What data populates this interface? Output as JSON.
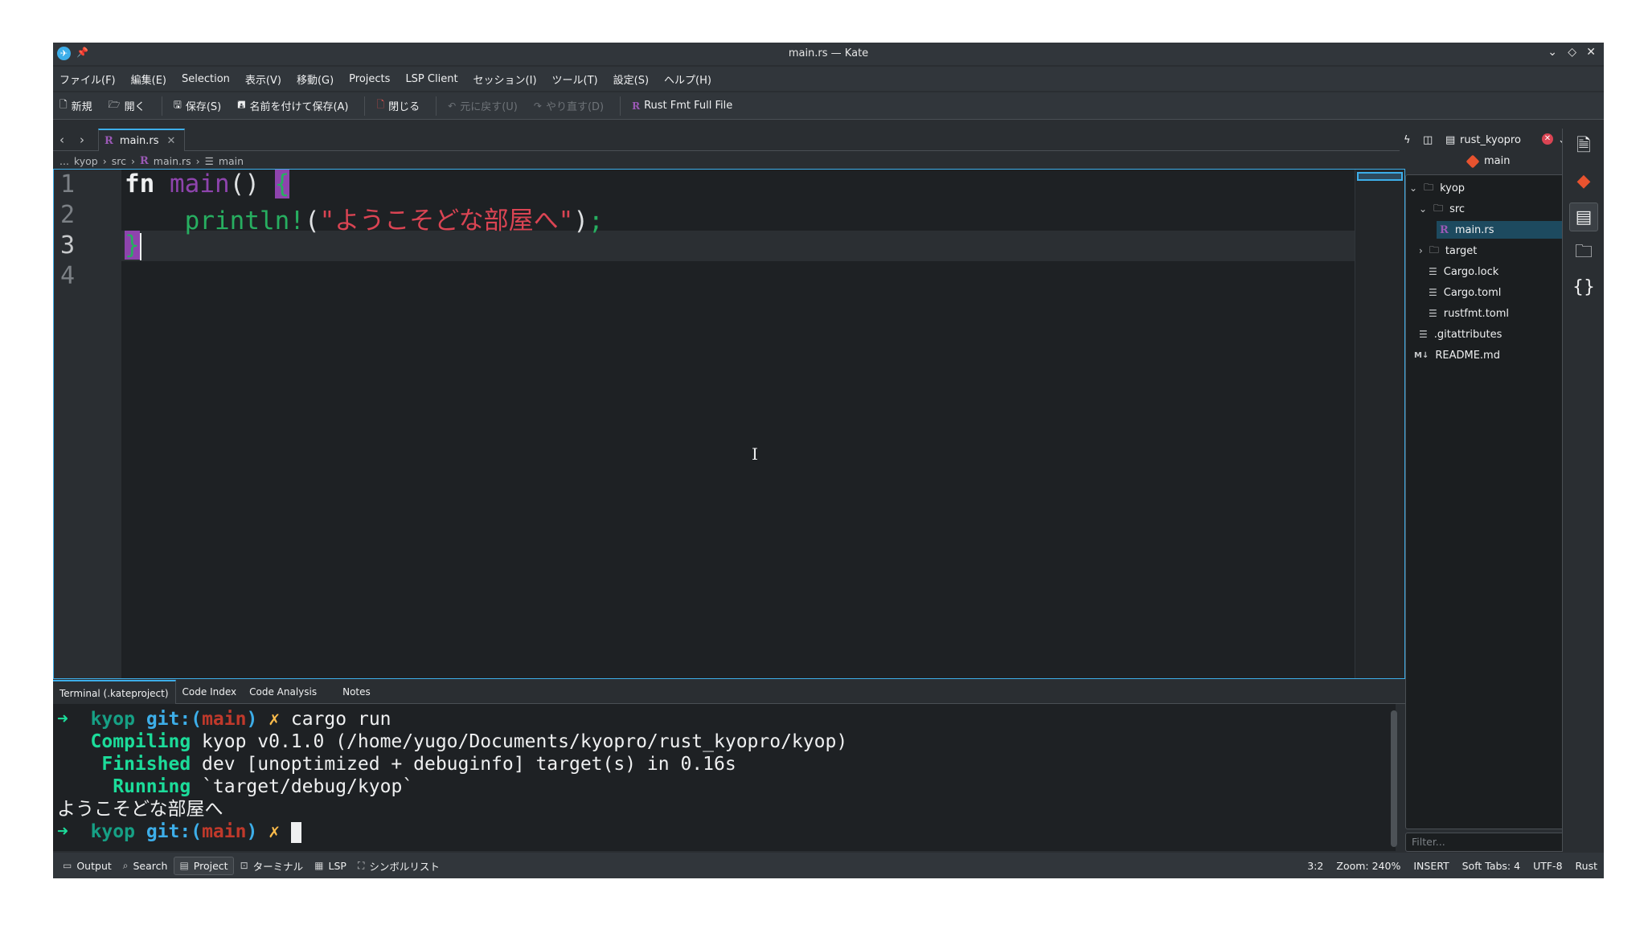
{
  "window": {
    "title": "main.rs — Kate",
    "controls": [
      "minimize",
      "maximize",
      "close"
    ]
  },
  "menu": [
    "ファイル(F)",
    "編集(E)",
    "Selection",
    "表示(V)",
    "移動(G)",
    "Projects",
    "LSP Client",
    "セッション(I)",
    "ツール(T)",
    "設定(S)",
    "ヘルプ(H)"
  ],
  "toolbar": {
    "new": "新規",
    "open": "開く",
    "save": "保存(S)",
    "save_as": "名前を付けて保存(A)",
    "close": "閉じる",
    "undo": "元に戻す(U)",
    "redo": "やり直す(D)",
    "rustfmt": "Rust Fmt Full File"
  },
  "tabs": [
    {
      "label": "main.rs",
      "active": true
    }
  ],
  "breadcrumb": [
    "...",
    "kyop",
    "src",
    "main.rs",
    "main"
  ],
  "editor": {
    "line_numbers": [
      "1",
      "2",
      "3",
      "4"
    ],
    "lines": {
      "l1_kw": "fn",
      "l1_fn": "main",
      "l1_parens": "()",
      "l1_brace": "{",
      "l2_indent": "    ",
      "l2_macro": "println!",
      "l2_open": "(",
      "l2_str": "\"ようこそどな部屋へ\"",
      "l2_close": ")",
      "l2_semi": ";",
      "l3_brace": "}"
    },
    "cursor": "3:2"
  },
  "bottom_tabs": [
    "Terminal (.kateproject)",
    "Code Index",
    "Code Analysis",
    "Notes"
  ],
  "terminal": {
    "prompt_arrow": "➜",
    "prompt_dir": "kyop",
    "prompt_git": "git:(",
    "prompt_branch": "main",
    "prompt_git_close": ")",
    "prompt_dirty": "✗",
    "command": "cargo run",
    "compiling_label": "Compiling",
    "compiling_text": "kyop v0.1.0 (/home/yugo/Documents/kyopro/rust_kyopro/kyop)",
    "finished_label": "Finished",
    "finished_text": "dev [unoptimized + debuginfo] target(s) in 0.16s",
    "running_label": "Running",
    "running_text": "`target/debug/kyop`",
    "output": "ようこそどな部屋へ"
  },
  "statusbar": {
    "left": [
      "Output",
      "Search",
      "Project",
      "ターミナル",
      "LSP",
      "シンボルリスト"
    ],
    "active": "Project",
    "position": "3:2",
    "zoom": "Zoom: 240%",
    "mode": "INSERT",
    "indent": "Soft Tabs: 4",
    "encoding": "UTF-8",
    "language": "Rust"
  },
  "project": {
    "name": "rust_kyopro",
    "branch": "main",
    "tree": [
      {
        "label": "kyop",
        "type": "folder",
        "expanded": true
      },
      {
        "label": "src",
        "type": "folder",
        "expanded": true
      },
      {
        "label": "main.rs",
        "type": "rust",
        "selected": true
      },
      {
        "label": "target",
        "type": "folder",
        "expanded": false
      },
      {
        "label": "Cargo.lock",
        "type": "file"
      },
      {
        "label": "Cargo.toml",
        "type": "file"
      },
      {
        "label": "rustfmt.toml",
        "type": "file"
      },
      {
        "label": ".gitattributes",
        "type": "file"
      },
      {
        "label": "README.md",
        "type": "markdown"
      }
    ],
    "filter_placeholder": "Filter..."
  },
  "colors": {
    "accent": "#3daee9",
    "git": "#e8532f",
    "rust": "#9b59b6",
    "string": "#da4453"
  }
}
